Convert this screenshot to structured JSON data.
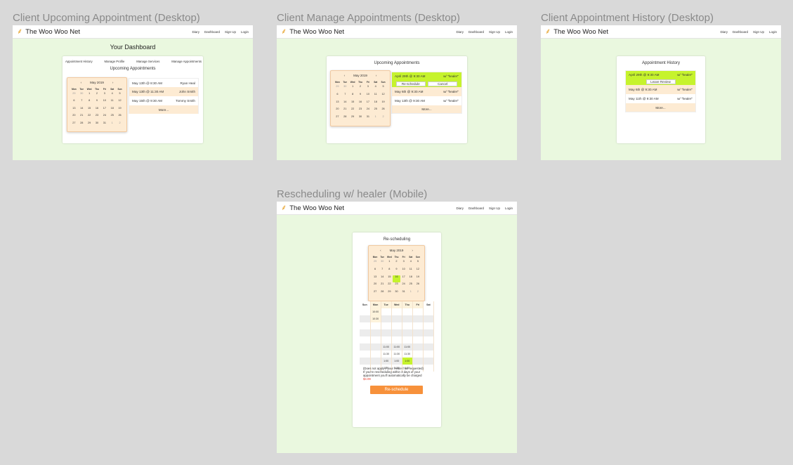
{
  "brand": {
    "name": "The Woo Woo Net",
    "icon": "wheat-icon"
  },
  "nav": [
    "Diary",
    "Dashboard",
    "Sign Up",
    "Login"
  ],
  "calendar": {
    "month": "May 2019",
    "prev": "‹",
    "next": "›",
    "weekdays": [
      "Mon",
      "Tue",
      "Wed",
      "Thu",
      "Fri",
      "Sat",
      "Sun"
    ],
    "days": [
      {
        "d": "29",
        "m": true
      },
      {
        "d": "30",
        "m": true
      },
      {
        "d": "1"
      },
      {
        "d": "2"
      },
      {
        "d": "3"
      },
      {
        "d": "4"
      },
      {
        "d": "5"
      },
      {
        "d": "6"
      },
      {
        "d": "7"
      },
      {
        "d": "8"
      },
      {
        "d": "9"
      },
      {
        "d": "10"
      },
      {
        "d": "11"
      },
      {
        "d": "12"
      },
      {
        "d": "13"
      },
      {
        "d": "14"
      },
      {
        "d": "15"
      },
      {
        "d": "16"
      },
      {
        "d": "17"
      },
      {
        "d": "18"
      },
      {
        "d": "19"
      },
      {
        "d": "20"
      },
      {
        "d": "21"
      },
      {
        "d": "22"
      },
      {
        "d": "23"
      },
      {
        "d": "24"
      },
      {
        "d": "25"
      },
      {
        "d": "26"
      },
      {
        "d": "27"
      },
      {
        "d": "28"
      },
      {
        "d": "29"
      },
      {
        "d": "30"
      },
      {
        "d": "31"
      },
      {
        "d": "1",
        "m": true
      },
      {
        "d": "2",
        "m": true
      }
    ]
  },
  "frames": {
    "upcoming": {
      "label": "Client Upcoming Appointment (Desktop)",
      "page_title": "Your Dashboard",
      "tabs": [
        "Appointment History",
        "Manage Profile",
        "Manage Services",
        "Manage Appointments"
      ],
      "card_title": "Upcoming Appointments",
      "appointments": [
        {
          "time": "May 13th @ 8:30 AM",
          "healer": "Ryan Heal"
        },
        {
          "time": "May 13th @ 11:30 AM",
          "healer": "John Smith"
        },
        {
          "time": "May 15th @ 9:30 AM",
          "healer": "Tommy Smith"
        }
      ],
      "more": "More..."
    },
    "manage": {
      "label": "Client Manage Appointments (Desktop)",
      "card_title": "Upcoming Appointments",
      "appointments": [
        {
          "time": "April 29th @ 9:30 AM",
          "healer": "w/ \"healer\""
        },
        {
          "time": "May 6th @ 9:30 AM",
          "healer": "w/ \"healer\""
        },
        {
          "time": "May 13th @ 9:30 AM",
          "healer": "w/ \"healer\""
        }
      ],
      "reschedule": "Re-schedule",
      "cancel": "Cancel",
      "more": "More..."
    },
    "history": {
      "label": "Client Appointment History (Desktop)",
      "card_title": "Appointment History",
      "appointments": [
        {
          "time": "April 29th @ 9:30 AM",
          "healer": "w/ \"healer\""
        },
        {
          "time": "May 6th @ 9:30 AM",
          "healer": "w/ \"healer\""
        },
        {
          "time": "May 11th @ 9:30 AM",
          "healer": "w/ \"healer\""
        }
      ],
      "leave_review": "Leave Review",
      "more": "More..."
    },
    "reschedule": {
      "label": "Rescheduling w/ healer (Mobile)",
      "card_title": "Re-scheduling",
      "selected_day": "16",
      "schedule": {
        "days": [
          "Sun",
          "Mon",
          "Tue",
          "Wed",
          "Thu",
          "Fri",
          "Sat"
        ],
        "rows": [
          [
            "",
            "10:00",
            "",
            "",
            "",
            "",
            ""
          ],
          [
            "",
            "10:30",
            "",
            "",
            "",
            "",
            ""
          ],
          [
            "",
            "",
            "",
            "",
            "",
            "",
            ""
          ],
          [
            "",
            "",
            "",
            "",
            "",
            "",
            ""
          ],
          [
            "",
            "",
            "",
            "",
            "",
            "",
            ""
          ],
          [
            "",
            "",
            "11:00",
            "11:00",
            "11:00",
            "",
            ""
          ],
          [
            "",
            "",
            "11:30",
            "11:30",
            "11:30",
            "",
            ""
          ],
          [
            "",
            "",
            "1:00",
            "1:00",
            "1:00",
            "",
            ""
          ],
          [
            "",
            "",
            "1:30",
            "1:30",
            "1:30",
            "",
            ""
          ]
        ],
        "selected_slot": "1:00"
      },
      "note_line1": "(Does not apply if your healer has requested)",
      "note_line2": "If you're rescheduling within 3 days of your",
      "note_line3": "appointment you'll automatically be charged",
      "price": "$4.09",
      "button": "Re-schedule"
    }
  },
  "colors": {
    "accent_green": "#c6f32d",
    "peach": "#fdebd3",
    "orange": "#f7913b",
    "frame_bg": "#eaf8df"
  }
}
